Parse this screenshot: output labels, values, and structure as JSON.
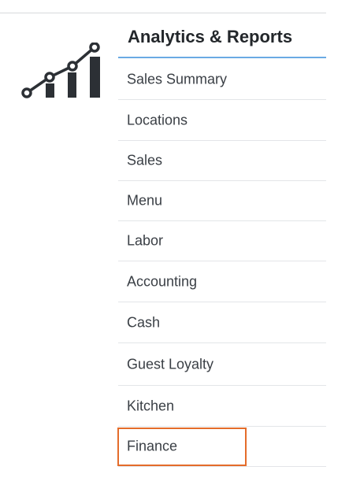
{
  "icons": {
    "logo": "analytics-chart-icon"
  },
  "colors": {
    "title_underline": "#6aaae4",
    "highlight_border": "#e46c2a",
    "logo": "#2c3035"
  },
  "menu": {
    "title": "Analytics & Reports",
    "items": [
      {
        "label": "Sales Summary"
      },
      {
        "label": "Locations"
      },
      {
        "label": "Sales"
      },
      {
        "label": "Menu"
      },
      {
        "label": "Labor"
      },
      {
        "label": "Accounting"
      },
      {
        "label": "Cash"
      },
      {
        "label": "Guest Loyalty"
      },
      {
        "label": "Kitchen"
      },
      {
        "label": "Finance"
      }
    ],
    "highlighted_item": "Finance"
  }
}
